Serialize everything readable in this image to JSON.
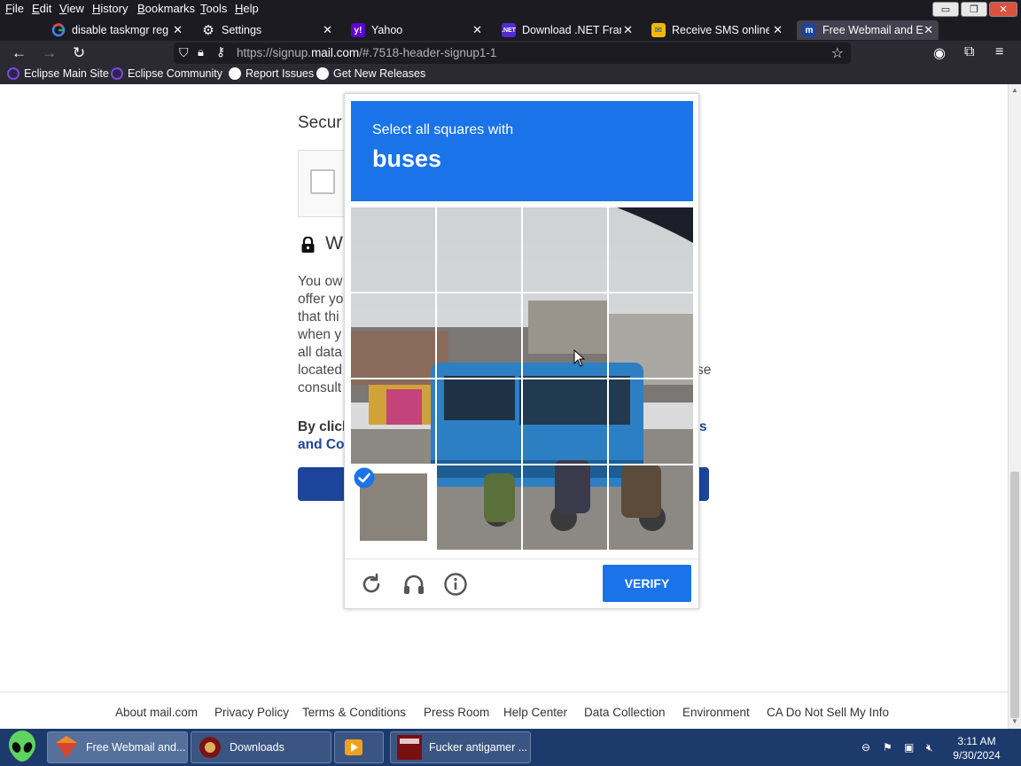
{
  "menubar": {
    "items": [
      "File",
      "Edit",
      "View",
      "History",
      "Bookmarks",
      "Tools",
      "Help"
    ],
    "accesskeys": [
      "F",
      "E",
      "V",
      "H",
      "B",
      "T",
      "H"
    ]
  },
  "tabs": [
    {
      "title": "disable taskmgr reg -",
      "icon": "google-icon"
    },
    {
      "title": "Settings",
      "icon": "gear-icon"
    },
    {
      "title": "Yahoo",
      "icon": "yahoo-icon"
    },
    {
      "title": "Download .NET Fram",
      "icon": "dotnet-icon"
    },
    {
      "title": "Receive SMS online |",
      "icon": "sms-icon"
    },
    {
      "title": "Free Webmail and Em",
      "icon": "mail-com-icon",
      "active": true
    }
  ],
  "tab_count": "6",
  "navbar": {
    "url_prefix": "https://signup.",
    "url_domain": "mail.com",
    "url_rest": "/#.7518-header-signup1-1"
  },
  "bookmarks": [
    "Eclipse Main Site",
    "Eclipse Community",
    "Report Issues",
    "Get New Releases"
  ],
  "page": {
    "secure_heading": "Secur",
    "we_heading": "W",
    "body_lines": [
      "You ow",
      "offer yo",
      "that thi",
      "when y",
      "all data",
      "located",
      "consult"
    ],
    "body_tail": [
      "se"
    ],
    "bold_line1": "By click",
    "bold_line1_tail": "s",
    "bold_line2": "and Co"
  },
  "captcha": {
    "prompt": "Select all squares with",
    "object": "buses",
    "selected_tiles": [
      12
    ],
    "verify_label": "VERIFY",
    "header_color": "#1a73e8"
  },
  "footer": {
    "links": [
      "About mail.com",
      "Privacy Policy",
      "Terms & Conditions",
      "Press Room",
      "Help Center",
      "Data Collection",
      "Environment",
      "CA Do Not Sell My Info"
    ]
  },
  "taskbar": {
    "tasks": [
      "Free Webmail and...",
      "Downloads",
      "",
      "Fucker antigamer ..."
    ],
    "time": "3:11 AM",
    "date": "9/30/2024"
  }
}
